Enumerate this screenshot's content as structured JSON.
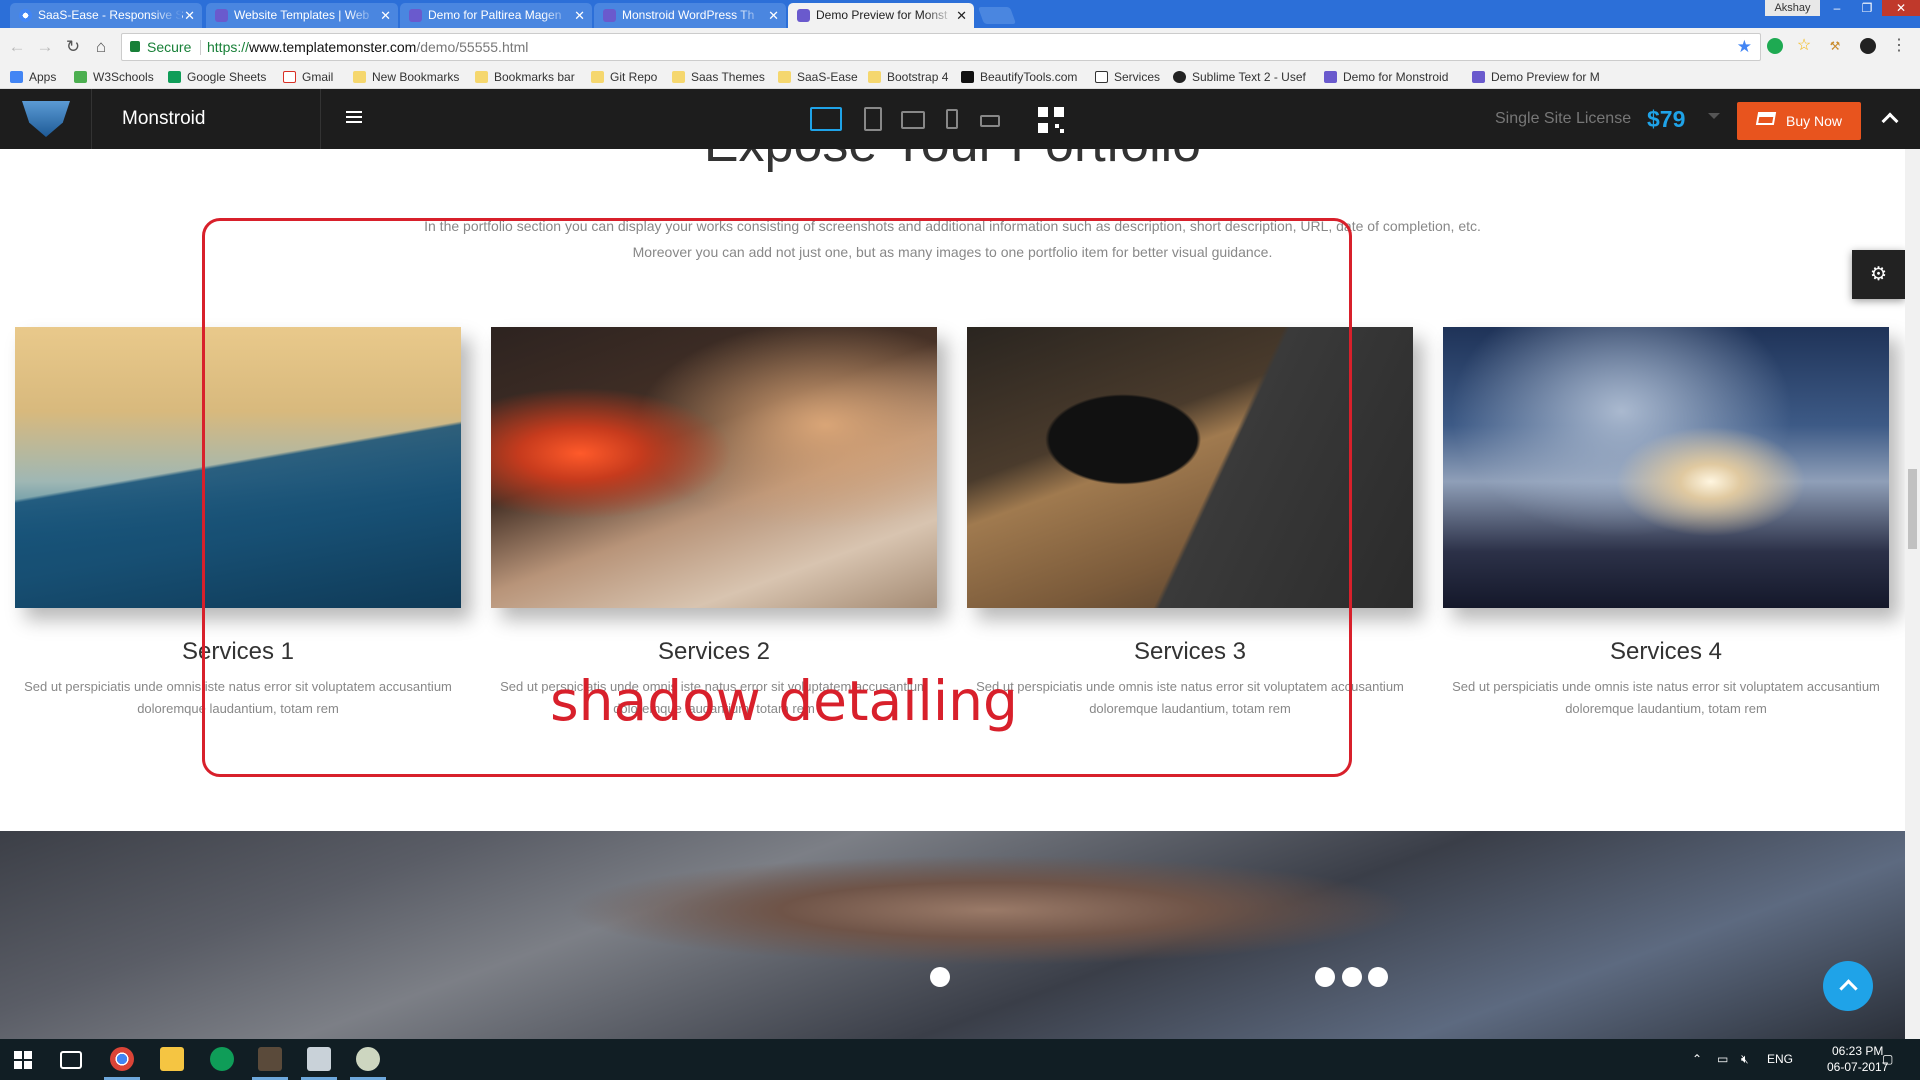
{
  "browser": {
    "tabs": [
      {
        "title": "SaaS-Ease - Responsive S",
        "active": false
      },
      {
        "title": "Website Templates | Web",
        "active": false
      },
      {
        "title": "Demo for Paltirea Magen",
        "active": false
      },
      {
        "title": "Monstroid WordPress Th",
        "active": false
      },
      {
        "title": "Demo Preview for Monst",
        "active": true
      }
    ],
    "user": "Akshay",
    "secure_label": "Secure",
    "url_protocol": "https://",
    "url_domain": "www.templatemonster.com",
    "url_path": "/demo/55555.html",
    "bookmarks": [
      {
        "label": "Apps",
        "icon": "apps-grid-icon"
      },
      {
        "label": "W3Schools",
        "icon": "w3schools-icon"
      },
      {
        "label": "Google Sheets",
        "icon": "sheets-icon"
      },
      {
        "label": "Gmail",
        "icon": "gmail-icon"
      },
      {
        "label": "New Bookmarks",
        "icon": "folder-icon"
      },
      {
        "label": "Bookmarks bar",
        "icon": "folder-icon"
      },
      {
        "label": "Git Repo",
        "icon": "folder-icon"
      },
      {
        "label": "Saas Themes",
        "icon": "folder-icon"
      },
      {
        "label": "SaaS-Ease",
        "icon": "folder-icon"
      },
      {
        "label": "Bootstrap 4",
        "icon": "folder-icon"
      },
      {
        "label": "BeautifyTools.com",
        "icon": "bt-icon"
      },
      {
        "label": "Services",
        "icon": "tumblr-icon"
      },
      {
        "label": "Sublime Text 2 - Usef",
        "icon": "github-icon"
      },
      {
        "label": "Demo for Monstroid",
        "icon": "tm-icon"
      },
      {
        "label": "Demo Preview for M",
        "icon": "tm-icon"
      }
    ]
  },
  "tm_bar": {
    "title": "Monstroid",
    "license": "Single Site License",
    "price": "$79",
    "buy_label": "Buy Now",
    "colors": {
      "accent": "#1fa3e8",
      "buy": "#e8541e"
    }
  },
  "content": {
    "section_title": "Expose Your Portfolio",
    "description_line1": "In the portfolio section you can display your works consisting of screenshots and additional information such as description, short description, URL, date of completion, etc.",
    "description_line2": "Moreover you can add not just one, but as many images to one portfolio item for better visual guidance.",
    "cards": [
      {
        "title": "Services 1",
        "text": "Sed ut perspiciatis unde omnis iste natus error sit voluptatem accusantium doloremque laudantium, totam rem"
      },
      {
        "title": "Services 2",
        "text": "Sed ut perspiciatis unde omnis iste natus error sit voluptatem accusantium doloremque laudantium, totam rem"
      },
      {
        "title": "Services 3",
        "text": "Sed ut perspiciatis unde omnis iste natus error sit voluptatem accusantium doloremque laudantium, totam rem"
      },
      {
        "title": "Services 4",
        "text": "Sed ut perspiciatis unde omnis iste natus error sit voluptatem accusantium doloremque laudantium, totam rem"
      }
    ],
    "annotation": "shadow detailing"
  },
  "taskbar": {
    "language": "ENG",
    "time": "06:23 PM",
    "date": "06-07-2017"
  }
}
